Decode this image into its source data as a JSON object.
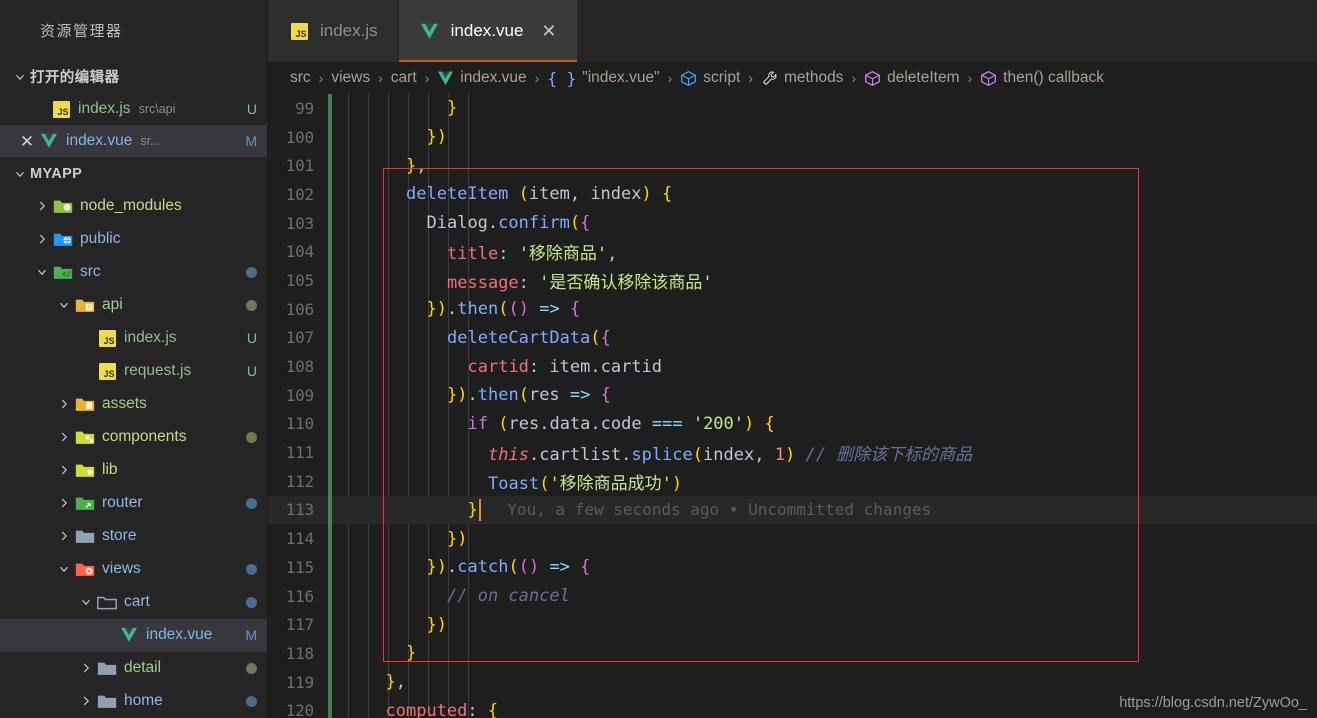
{
  "sidebar": {
    "title": "资源管理器",
    "open_editors": {
      "label": "打开的编辑器",
      "items": [
        {
          "icon": "js-file-icon",
          "name": "index.js",
          "sub": "src\\api",
          "badge": "U",
          "selected": false,
          "has_close": false
        },
        {
          "icon": "vue-file-icon",
          "name": "index.vue",
          "sub": "sr...",
          "badge": "M",
          "selected": true,
          "has_close": true
        }
      ]
    },
    "project": {
      "label": "MYAPP",
      "items": [
        {
          "name": "node_modules",
          "icon": "folder-node-icon",
          "indent": 1,
          "twisty": "right",
          "dot": "",
          "badge": ""
        },
        {
          "name": "public",
          "icon": "folder-public-icon",
          "indent": 1,
          "twisty": "right",
          "dot": "",
          "badge": ""
        },
        {
          "name": "src",
          "icon": "folder-src-icon",
          "indent": 1,
          "twisty": "down",
          "dot": "blue",
          "badge": ""
        },
        {
          "name": "api",
          "icon": "folder-api-icon",
          "indent": 2,
          "twisty": "down",
          "dot": "olive",
          "badge": ""
        },
        {
          "name": "index.js",
          "icon": "js-file-icon",
          "indent": 3,
          "twisty": "none",
          "dot": "",
          "badge": "U"
        },
        {
          "name": "request.js",
          "icon": "js-file-icon",
          "indent": 3,
          "twisty": "none",
          "dot": "",
          "badge": "U"
        },
        {
          "name": "assets",
          "icon": "folder-assets-icon",
          "indent": 2,
          "twisty": "right",
          "dot": "",
          "badge": ""
        },
        {
          "name": "components",
          "icon": "folder-comp-icon",
          "indent": 2,
          "twisty": "right",
          "dot": "olive",
          "badge": ""
        },
        {
          "name": "lib",
          "icon": "folder-lib-icon",
          "indent": 2,
          "twisty": "right",
          "dot": "",
          "badge": ""
        },
        {
          "name": "router",
          "icon": "folder-router-icon",
          "indent": 2,
          "twisty": "right",
          "dot": "blue",
          "badge": ""
        },
        {
          "name": "store",
          "icon": "folder-plain-icon",
          "indent": 2,
          "twisty": "right",
          "dot": "",
          "badge": ""
        },
        {
          "name": "views",
          "icon": "folder-views-icon",
          "indent": 2,
          "twisty": "down",
          "dot": "blue",
          "badge": ""
        },
        {
          "name": "cart",
          "icon": "folder-open-icon",
          "indent": 3,
          "twisty": "down",
          "dot": "blue",
          "badge": ""
        },
        {
          "name": "index.vue",
          "icon": "vue-file-icon",
          "indent": 4,
          "twisty": "none",
          "dot": "",
          "badge": "M",
          "selected": true
        },
        {
          "name": "detail",
          "icon": "folder-plain-icon",
          "indent": 3,
          "twisty": "right",
          "dot": "olive",
          "badge": ""
        },
        {
          "name": "home",
          "icon": "folder-plain-icon",
          "indent": 3,
          "twisty": "right",
          "dot": "blue",
          "badge": ""
        }
      ]
    }
  },
  "tabs": [
    {
      "label": "index.js",
      "icon": "js-file-icon",
      "active": false,
      "closable": false
    },
    {
      "label": "index.vue",
      "icon": "vue-file-icon",
      "active": true,
      "closable": true,
      "close_label": "✕"
    }
  ],
  "breadcrumb": [
    {
      "label": "src",
      "icon": ""
    },
    {
      "label": "views",
      "icon": ""
    },
    {
      "label": "cart",
      "icon": ""
    },
    {
      "label": "index.vue",
      "icon": "vue-file-icon"
    },
    {
      "label": "\"index.vue\"",
      "icon": "braces-icon"
    },
    {
      "label": "script",
      "icon": "cube-blue-icon"
    },
    {
      "label": "methods",
      "icon": "wrench-icon"
    },
    {
      "label": "deleteItem",
      "icon": "cube-purple-icon"
    },
    {
      "label": "then() callback",
      "icon": "cube-purple-icon"
    }
  ],
  "breadcrumb_separator": "›",
  "editor": {
    "first_line": 99,
    "current_line": 113,
    "blame": "You, a few seconds ago • Uncommitted changes",
    "lines": [
      {
        "n": 99,
        "text": "        }"
      },
      {
        "n": 100,
        "text": "      })"
      },
      {
        "n": 101,
        "text": "    },"
      },
      {
        "n": 102,
        "text": "    deleteItem (item, index) {"
      },
      {
        "n": 103,
        "text": "      Dialog.confirm({"
      },
      {
        "n": 104,
        "text": "        title: '移除商品',"
      },
      {
        "n": 105,
        "text": "        message: '是否确认移除该商品'"
      },
      {
        "n": 106,
        "text": "      }).then(() => {"
      },
      {
        "n": 107,
        "text": "        deleteCartData({"
      },
      {
        "n": 108,
        "text": "          cartid: item.cartid"
      },
      {
        "n": 109,
        "text": "        }).then(res => {"
      },
      {
        "n": 110,
        "text": "          if (res.data.code === '200') {"
      },
      {
        "n": 111,
        "text": "            this.cartlist.splice(index, 1) // 删除该下标的商品"
      },
      {
        "n": 112,
        "text": "            Toast('移除商品成功')"
      },
      {
        "n": 113,
        "text": "          }"
      },
      {
        "n": 114,
        "text": "        })"
      },
      {
        "n": 115,
        "text": "      }).catch(() => {"
      },
      {
        "n": 116,
        "text": "        // on cancel"
      },
      {
        "n": 117,
        "text": "      })"
      },
      {
        "n": 118,
        "text": "    }"
      },
      {
        "n": 119,
        "text": "  },"
      },
      {
        "n": 120,
        "text": "  computed: {"
      }
    ]
  },
  "annotation": {
    "type": "red-rectangle",
    "color": "#ff2d2d"
  },
  "watermark": "https://blog.csdn.net/ZywOo_",
  "colors": {
    "sidebar_bg": "#252526",
    "editor_bg": "#1e1e1e",
    "tab_active_border": "#c25a1b",
    "selection": "#37373d",
    "git_added": "#5a9c6e",
    "cursor": "#e08c4a",
    "annotation_red": "#ff2d2d"
  }
}
